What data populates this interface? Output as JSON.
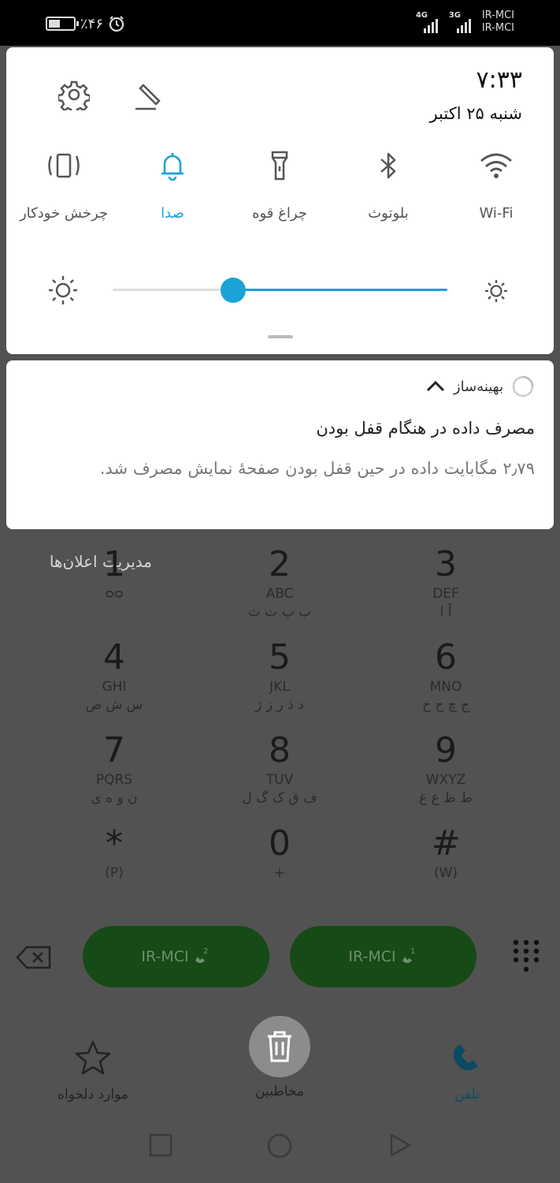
{
  "status_bar": {
    "battery_percent_text": "٪۴۶",
    "battery_level": 0.46,
    "signal": [
      {
        "network": "4G"
      },
      {
        "network": "3G"
      }
    ],
    "carriers": [
      "IR-MCI",
      "IR-MCI"
    ]
  },
  "quick_settings": {
    "time": "۷:۳۳",
    "date": "شنبه ۲۵ اکتبر",
    "tiles": [
      {
        "label": "چرخش خودکار",
        "icon": "auto-rotate-icon",
        "active": false
      },
      {
        "label": "صدا",
        "icon": "bell-icon",
        "active": true
      },
      {
        "label": "چراغ قوه",
        "icon": "flashlight-icon",
        "active": false
      },
      {
        "label": "بلوتوث",
        "icon": "bluetooth-icon",
        "active": false
      },
      {
        "label": "Wi-Fi",
        "icon": "wifi-icon",
        "active": false
      }
    ],
    "brightness_level": 0.66,
    "accent_color": "#1aa3d6"
  },
  "notification": {
    "app_name": "بهینه‌ساز",
    "title": "مصرف داده در هنگام قفل بودن",
    "body": "۲٫۷۹ مگابایت داده در حین قفل بودن صفحهٔ نمایش مصرف شد."
  },
  "manage_notifications": "مدیریت اعلان‌ها",
  "dialpad": {
    "keys": [
      {
        "digit": "1",
        "letters": "ᴑᴑ",
        "farsi": ""
      },
      {
        "digit": "2",
        "letters": "ABC",
        "farsi": "ب پ ت ث"
      },
      {
        "digit": "3",
        "letters": "DEF",
        "farsi": "آ ا"
      },
      {
        "digit": "4",
        "letters": "GHI",
        "farsi": "س ش ص"
      },
      {
        "digit": "5",
        "letters": "JKL",
        "farsi": "د ذ ر ز ژ"
      },
      {
        "digit": "6",
        "letters": "MNO",
        "farsi": "ج چ ح خ"
      },
      {
        "digit": "7",
        "letters": "PQRS",
        "farsi": "ن و ه ی"
      },
      {
        "digit": "8",
        "letters": "TUV",
        "farsi": "ف ق ک گ ل"
      },
      {
        "digit": "9",
        "letters": "WXYZ",
        "farsi": "ط ظ ع غ"
      },
      {
        "digit": "*",
        "letters": "(P)",
        "farsi": ""
      },
      {
        "digit": "0",
        "letters": "+",
        "farsi": ""
      },
      {
        "digit": "#",
        "letters": "(W)",
        "farsi": ""
      }
    ],
    "sim_buttons": [
      {
        "label": "IR-MCI",
        "slot": "2"
      },
      {
        "label": "IR-MCI",
        "slot": "1"
      }
    ],
    "sim_color": "#164a16"
  },
  "bottom_nav": {
    "tabs": [
      {
        "label": "موارد دلخواه",
        "icon": "star-icon"
      },
      {
        "label": "مخاطبین",
        "icon": "contacts-icon"
      },
      {
        "label": "تلفن",
        "icon": "phone-icon",
        "active": true
      }
    ]
  }
}
